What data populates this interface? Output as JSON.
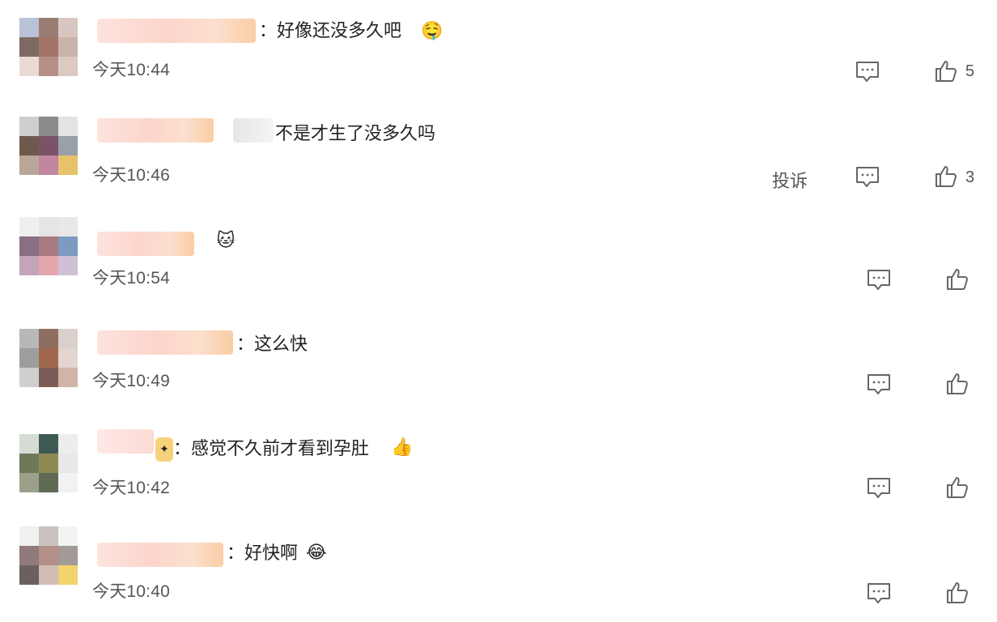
{
  "comments": [
    {
      "text": "：好像还没多久吧",
      "emoji": "🤤",
      "time": "今天10:44",
      "likes": "5"
    },
    {
      "text": "不是才生了没多久吗",
      "time": "今天10:46",
      "likes": "3",
      "report": "投诉"
    },
    {
      "text": "",
      "emoji": "🐱",
      "time": "今天10:54"
    },
    {
      "text": "：这么快",
      "time": "今天10:49"
    },
    {
      "text": "：感觉不久前才看到孕肚",
      "emoji": "👍",
      "time": "今天10:42"
    },
    {
      "text": "：好快啊",
      "emoji": "😂",
      "time": "今天10:40"
    }
  ],
  "icons": {
    "reply": "comment-bubble-icon",
    "like": "thumbs-up-icon"
  },
  "colors": {
    "text": "#222222",
    "meta": "#555555",
    "icon": "#666666"
  }
}
